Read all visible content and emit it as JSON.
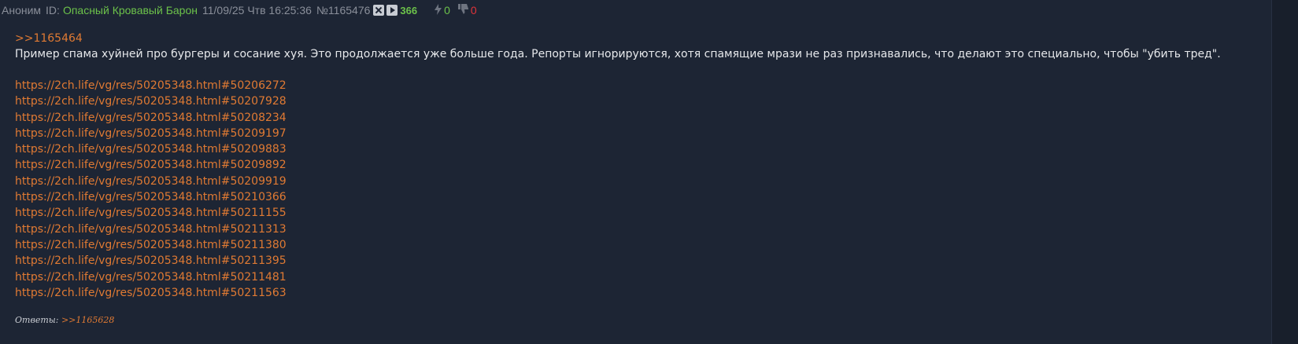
{
  "header": {
    "poster_name": "Аноним",
    "id_label": "ID:",
    "poster_nick": "Опасный Кровавый Барон",
    "date": "11/09/25 Чтв 16:25:36",
    "post_number": "№1165476",
    "view_count": "366",
    "likes": "0",
    "dislikes": "0"
  },
  "colors": {
    "background": "#1d2534",
    "link": "#e07a33",
    "nick": "#6cc24a",
    "dislike": "#e0343a"
  },
  "post": {
    "reply_to": ">>1165464",
    "message": "Пример спама хуйней про бургеры и сосание хуя. Это продолжается уже больше года. Репорты игнорируются, хотя спамящие мрази не раз признавались, что делают это специально, чтобы \"убить тред\".",
    "links": [
      "https://2ch.life/vg/res/50205348.html#50206272",
      "https://2ch.life/vg/res/50205348.html#50207928",
      "https://2ch.life/vg/res/50205348.html#50208234",
      "https://2ch.life/vg/res/50205348.html#50209197",
      "https://2ch.life/vg/res/50205348.html#50209883",
      "https://2ch.life/vg/res/50205348.html#50209892",
      "https://2ch.life/vg/res/50205348.html#50209919",
      "https://2ch.life/vg/res/50205348.html#50210366",
      "https://2ch.life/vg/res/50205348.html#50211155",
      "https://2ch.life/vg/res/50205348.html#50211313",
      "https://2ch.life/vg/res/50205348.html#50211380",
      "https://2ch.life/vg/res/50205348.html#50211395",
      "https://2ch.life/vg/res/50205348.html#50211481",
      "https://2ch.life/vg/res/50205348.html#50211563"
    ]
  },
  "replies": {
    "label": "Ответы:",
    "items": [
      ">>1165628"
    ]
  }
}
